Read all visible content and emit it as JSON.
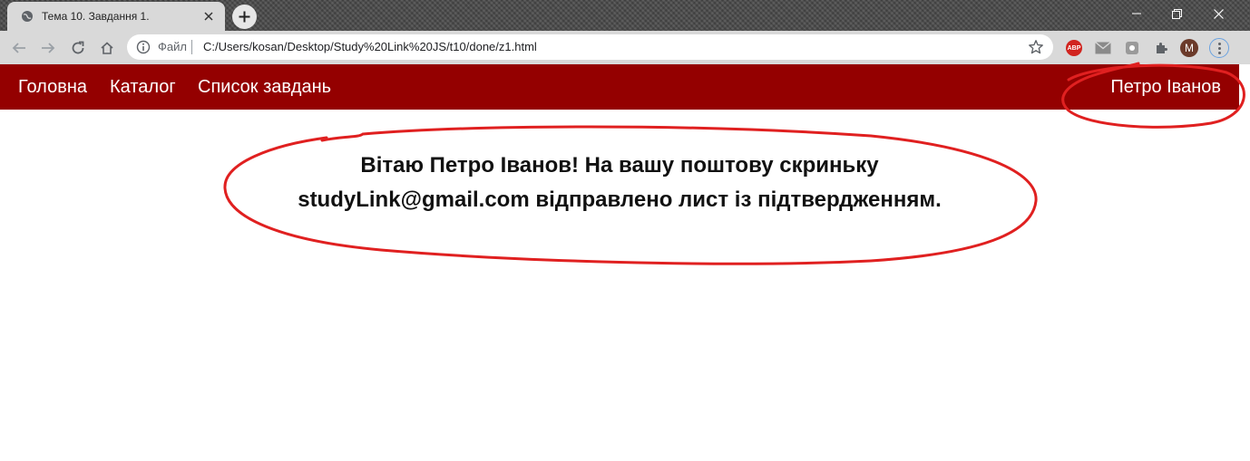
{
  "browser": {
    "tab_title": "Тема 10. Завдання 1.",
    "address": {
      "scheme_label": "Файл",
      "url": "C:/Users/kosan/Desktop/Study%20Link%20JS/t10/done/z1.html"
    },
    "profile_initial": "M",
    "abp_label": "ABP"
  },
  "navbar": {
    "links": [
      "Головна",
      "Каталог",
      "Список завдань"
    ],
    "user_name": "Петро Іванов",
    "background": "#940000"
  },
  "message": {
    "line1": "Вітаю Петро Іванов! На вашу поштову скриньку",
    "line2": "studyLink@gmail.com відправлено лист із підтвердженням."
  },
  "annotation_color": "#e02020"
}
